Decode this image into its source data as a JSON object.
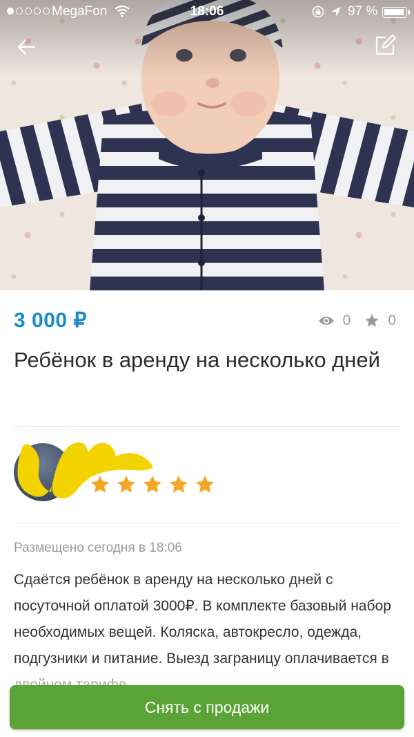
{
  "status_bar": {
    "carrier": "MegaFon",
    "time": "18:06",
    "battery": "97 %"
  },
  "listing": {
    "price": "3 000 ₽",
    "views": "0",
    "favorites": "0",
    "title": "Ребёнок в аренду на несколько дней",
    "posted": "Размещено сегодня в 18:06",
    "description": "Сдаётся ребёнок в аренду на несколько дней с посуточной оплатой 3000₽. В комплекте базовый набор необходимых вещей. Коляска, автокресло, одежда, подгузники и питание. Выезд заграницу оплачивается в двойном тарифе."
  },
  "seller": {
    "rating": 5,
    "rating_max": 5
  },
  "actions": {
    "unpublish_label": "Снять с продажи"
  },
  "colors": {
    "price": "#1a8bc8",
    "primary_button": "#5aa336",
    "star": "#f5a623"
  },
  "icons": {
    "back": "back-arrow-icon",
    "edit": "edit-icon",
    "views": "eye-icon",
    "favorites": "star-icon"
  }
}
